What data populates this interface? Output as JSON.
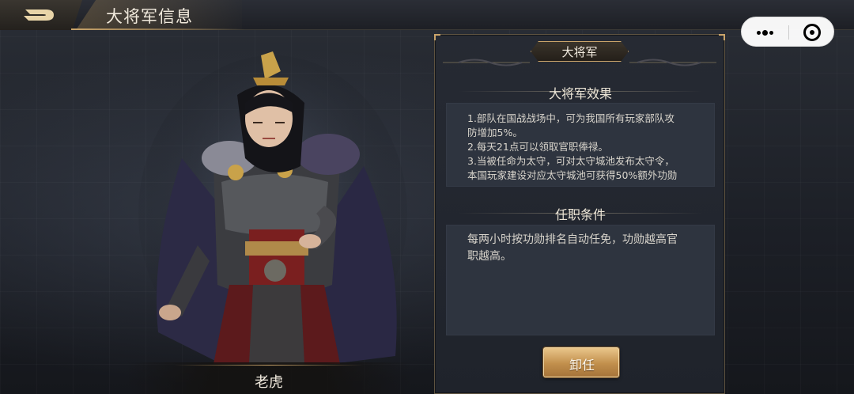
{
  "header": {
    "title": "大将军信息"
  },
  "capsule": {
    "more_icon": "more-dots-icon",
    "close_icon": "target-circle-icon"
  },
  "character": {
    "name": "老虎"
  },
  "panel": {
    "rank_title": "大将军",
    "effect_section": {
      "title": "大将军效果",
      "lines": [
        "1.部队在国战战场中，可为我国所有玩家部队攻",
        "防增加5%。",
        "2.每天21点可以领取官职俸禄。",
        "3.当被任命为太守，可对太守城池发布太守令，",
        "本国玩家建设对应太守城池可获得50%额外功勋"
      ]
    },
    "condition_section": {
      "title": "任职条件",
      "lines": [
        "每两小时按功勋排名自动任免，功勋越高官",
        "职越高。"
      ]
    },
    "resign_button": "卸任"
  },
  "colors": {
    "accent_gold": "#c9a46a",
    "panel_bg": "#262a33",
    "textbox_bg": "#2e343f"
  }
}
